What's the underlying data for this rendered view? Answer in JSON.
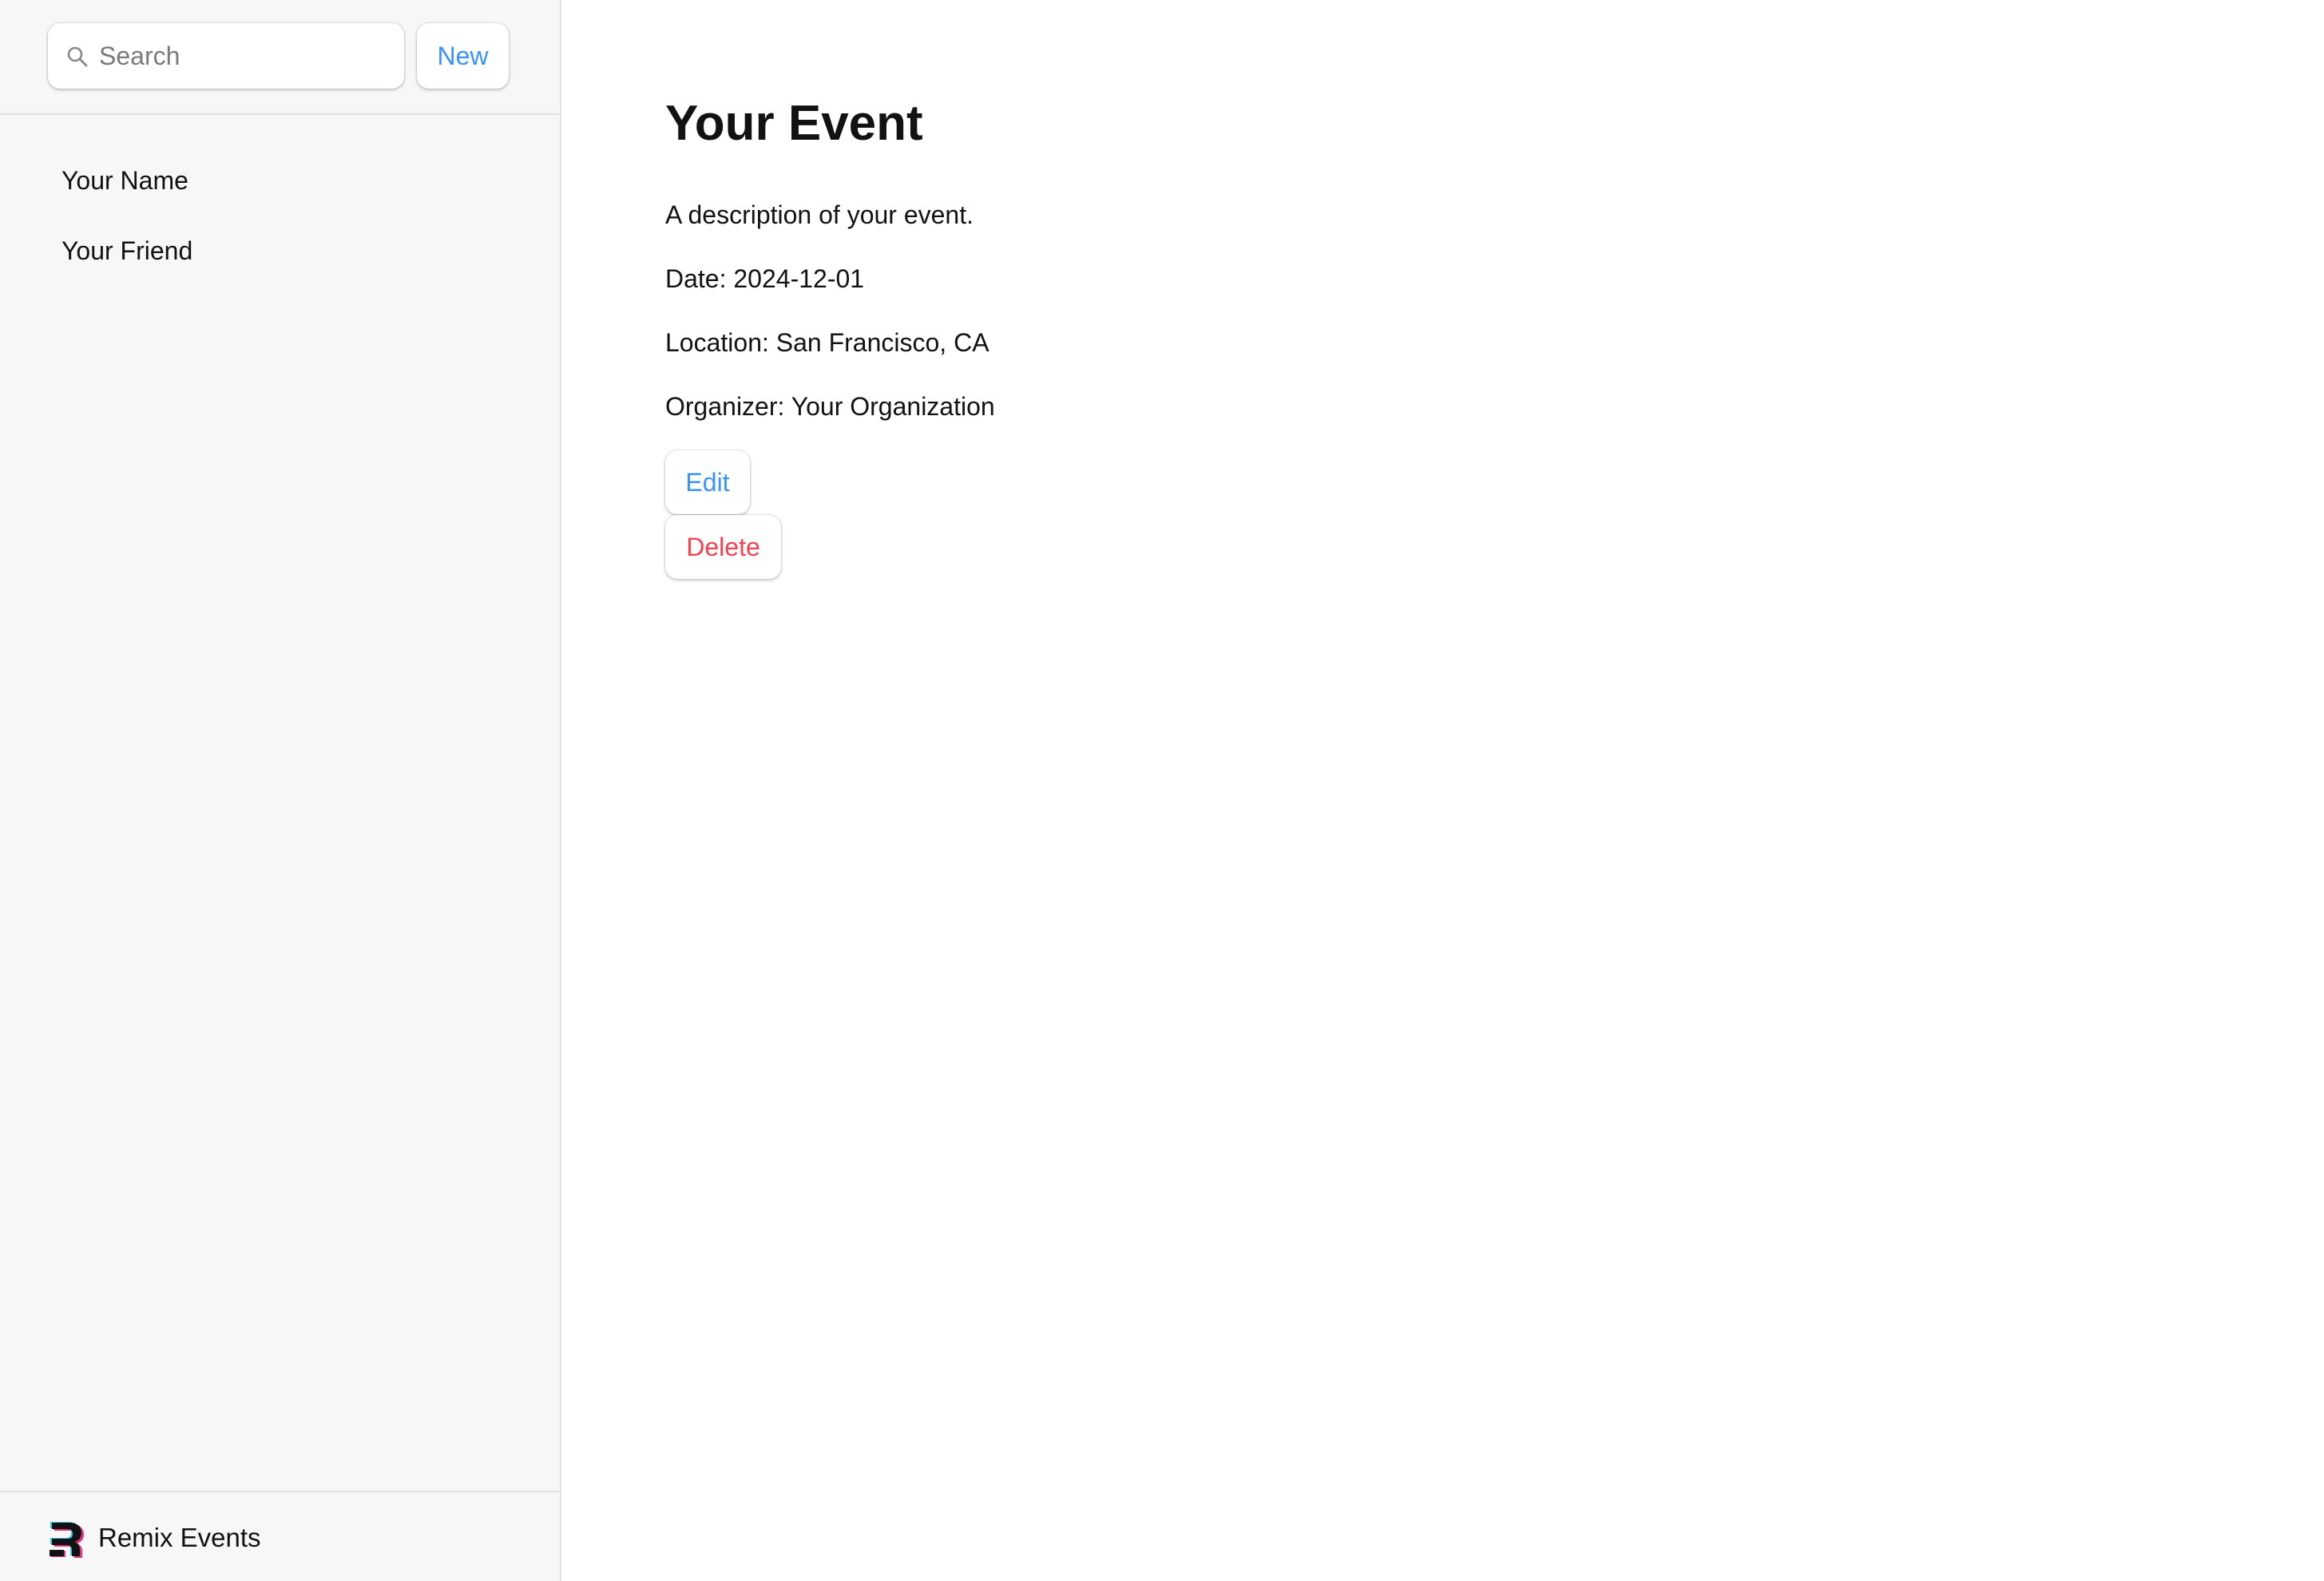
{
  "sidebar": {
    "search": {
      "placeholder": "Search",
      "value": "",
      "icon": "search-icon"
    },
    "new_label": "New",
    "items": [
      {
        "label": "Your Name"
      },
      {
        "label": "Your Friend"
      }
    ],
    "footer": {
      "brand": "Remix Events",
      "logo_icon": "remix-logo-icon"
    }
  },
  "event": {
    "title": "Your Event",
    "description": "A description of your event.",
    "date": "Date: 2024-12-01",
    "location": "Location: San Francisco, CA",
    "organizer": "Organizer: Your Organization",
    "edit_label": "Edit",
    "delete_label": "Delete"
  },
  "colors": {
    "accent": "#3992ff",
    "danger": "#f44250",
    "sidebar_bg": "#f7f7f7",
    "text": "#121212"
  }
}
